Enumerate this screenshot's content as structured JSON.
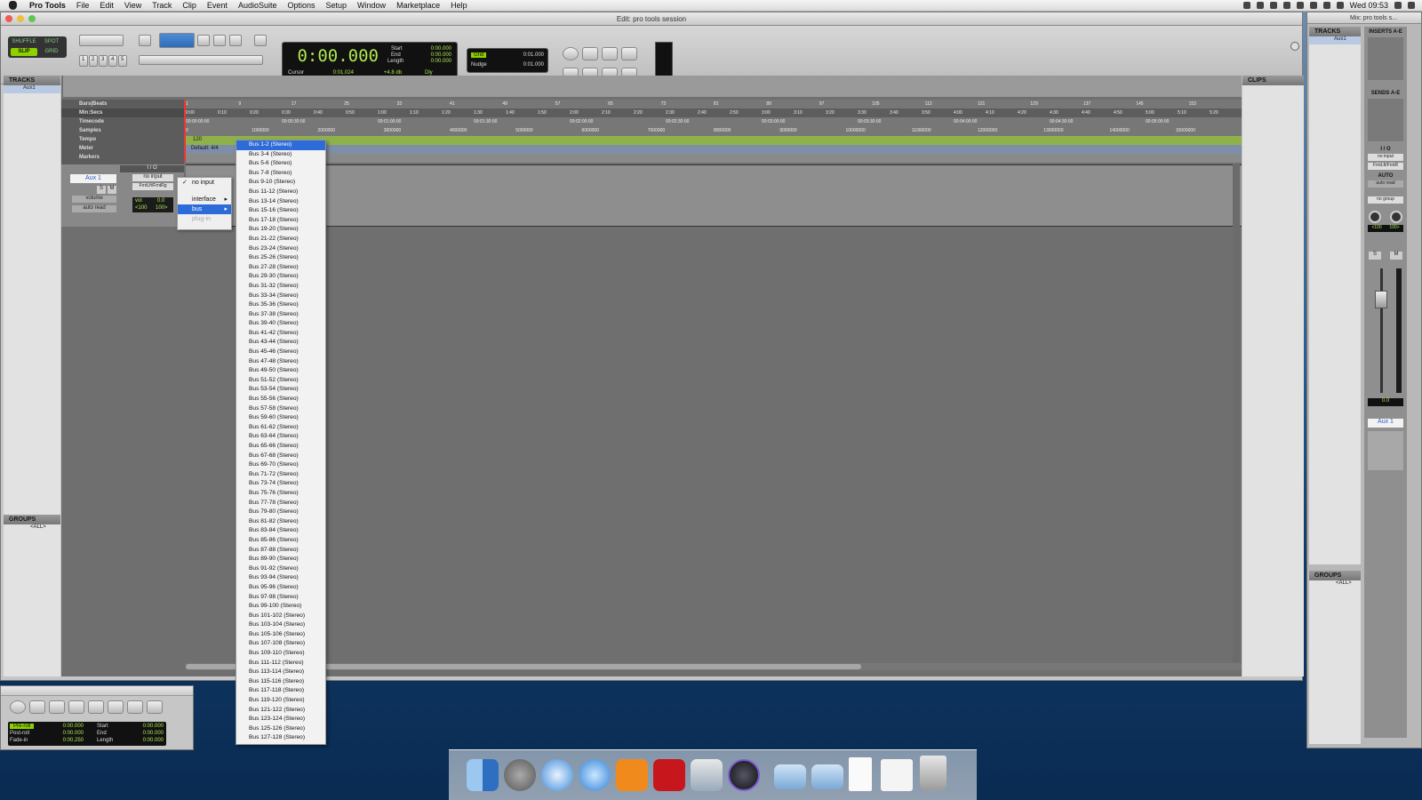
{
  "menubar": {
    "app_name": "Pro Tools",
    "menus": [
      "File",
      "Edit",
      "View",
      "Track",
      "Clip",
      "Event",
      "AudioSuite",
      "Options",
      "Setup",
      "Window",
      "Marketplace",
      "Help"
    ],
    "clock": "Wed 09:53"
  },
  "edit_window": {
    "title": "Edit: pro tools session",
    "modes": {
      "shuffle": "SHUFFLE",
      "spot": "SPOT",
      "slip": "SLIP",
      "grid": "GRID"
    },
    "zoom_presets": [
      "1",
      "2",
      "3",
      "4",
      "5"
    ],
    "counter": {
      "main": "0:00.000",
      "start_label": "Start",
      "start": "0:00.000",
      "end_label": "End",
      "end": "0:00.000",
      "length_label": "Length",
      "length": "0:00.000",
      "cursor_label": "Cursor",
      "cursor": "0:01.024",
      "level": "+4.8 db",
      "dly": "Dly"
    },
    "grid": {
      "grid_label": "Grid",
      "grid_value": "0:01.000",
      "nudge_label": "Nudge",
      "nudge_value": "0:01.000"
    }
  },
  "tracks_panel": {
    "header": "TRACKS",
    "items": [
      "Aux1"
    ]
  },
  "groups_panel": {
    "header": "GROUPS",
    "items": [
      "<ALL>"
    ]
  },
  "clips_panel": {
    "header": "CLIPS"
  },
  "rulers": {
    "labels": [
      "Bars|Beats",
      "Min:Secs",
      "Timecode",
      "Samples",
      "Tempo",
      "Meter",
      "Markers"
    ],
    "bars": [
      "1",
      "9",
      "17",
      "25",
      "33",
      "41",
      "49",
      "57",
      "65",
      "73",
      "81",
      "89",
      "97",
      "105",
      "113",
      "121",
      "129",
      "137",
      "145",
      "153"
    ],
    "minsecs": [
      "0:00",
      "0:10",
      "0:20",
      "0:30",
      "0:40",
      "0:50",
      "1:00",
      "1:10",
      "1:20",
      "1:30",
      "1:40",
      "1:50",
      "2:00",
      "2:10",
      "2:20",
      "2:30",
      "2:40",
      "2:50",
      "3:00",
      "3:10",
      "3:20",
      "3:30",
      "3:40",
      "3:50",
      "4:00",
      "4:10",
      "4:20",
      "4:30",
      "4:40",
      "4:50",
      "5:00",
      "5:10",
      "5:20"
    ],
    "timecode": [
      "00:00:00:00",
      "00:00:30:00",
      "00:01:00:00",
      "00:01:30:00",
      "00:02:00:00",
      "00:02:30:00",
      "00:03:00:00",
      "00:03:30:00",
      "00:04:00:00",
      "00:04:30:00",
      "00:05:00:00"
    ],
    "samples": [
      "0",
      "1000000",
      "2000000",
      "3000000",
      "4000000",
      "5000000",
      "6000000",
      "7000000",
      "8000000",
      "9000000",
      "10000000",
      "11000000",
      "12000000",
      "13000000",
      "14000000",
      "15000000"
    ],
    "tempo_value": "120",
    "meter_value": "Default: 4/4"
  },
  "track": {
    "name": "Aux 1",
    "io_header": "I / O",
    "input": "no input",
    "output": "FrntLft/FrntRg",
    "solo": "S",
    "mute": "M",
    "view": "volume",
    "automation": "auto read",
    "vol_label": "vol",
    "vol_value": "0.0",
    "pan_left": "<100",
    "pan_right": "100>"
  },
  "input_popup": {
    "items": [
      {
        "label": "no input",
        "checked": true
      },
      {
        "label": "interface",
        "arrow": true
      },
      {
        "label": "bus",
        "arrow": true
      },
      {
        "label": "plug-in",
        "disabled": true
      }
    ]
  },
  "bus_menu": {
    "items": [
      "Bus 1-2 (Stereo)",
      "Bus 3-4 (Stereo)",
      "Bus 5-6 (Stereo)",
      "Bus 7-8 (Stereo)",
      "Bus 9-10 (Stereo)",
      "Bus 11-12 (Stereo)",
      "Bus 13-14 (Stereo)",
      "Bus 15-16 (Stereo)",
      "Bus 17-18 (Stereo)",
      "Bus 19-20 (Stereo)",
      "Bus 21-22 (Stereo)",
      "Bus 23-24 (Stereo)",
      "Bus 25-26 (Stereo)",
      "Bus 27-28 (Stereo)",
      "Bus 29-30 (Stereo)",
      "Bus 31-32 (Stereo)",
      "Bus 33-34 (Stereo)",
      "Bus 35-36 (Stereo)",
      "Bus 37-38 (Stereo)",
      "Bus 39-40 (Stereo)",
      "Bus 41-42 (Stereo)",
      "Bus 43-44 (Stereo)",
      "Bus 45-46 (Stereo)",
      "Bus 47-48 (Stereo)",
      "Bus 49-50 (Stereo)",
      "Bus 51-52 (Stereo)",
      "Bus 53-54 (Stereo)",
      "Bus 55-56 (Stereo)",
      "Bus 57-58 (Stereo)",
      "Bus 59-60 (Stereo)",
      "Bus 61-62 (Stereo)",
      "Bus 63-64 (Stereo)",
      "Bus 65-66 (Stereo)",
      "Bus 67-68 (Stereo)",
      "Bus 69-70 (Stereo)",
      "Bus 71-72 (Stereo)",
      "Bus 73-74 (Stereo)",
      "Bus 75-76 (Stereo)",
      "Bus 77-78 (Stereo)",
      "Bus 79-80 (Stereo)",
      "Bus 81-82 (Stereo)",
      "Bus 83-84 (Stereo)",
      "Bus 85-86 (Stereo)",
      "Bus 87-88 (Stereo)",
      "Bus 89-90 (Stereo)",
      "Bus 91-92 (Stereo)",
      "Bus 93-94 (Stereo)",
      "Bus 95-96 (Stereo)",
      "Bus 97-98 (Stereo)",
      "Bus 99-100 (Stereo)",
      "Bus 101-102 (Stereo)",
      "Bus 103-104 (Stereo)",
      "Bus 105-106 (Stereo)",
      "Bus 107-108 (Stereo)",
      "Bus 109-110 (Stereo)",
      "Bus 111-112 (Stereo)",
      "Bus 113-114 (Stereo)",
      "Bus 115-116 (Stereo)",
      "Bus 117-118 (Stereo)",
      "Bus 119-120 (Stereo)",
      "Bus 121-122 (Stereo)",
      "Bus 123-124 (Stereo)",
      "Bus 125-126 (Stereo)",
      "Bus 127-128 (Stereo)"
    ]
  },
  "transport_window": {
    "preroll_label": "Pre-roll",
    "preroll": "0:00.000",
    "postroll_label": "Post-roll",
    "postroll": "0:00.000",
    "fadein_label": "Fade-in",
    "fadein": "0:00.250",
    "start_label": "Start",
    "start": "0:00.000",
    "end_label": "End",
    "end": "0:00.000",
    "length_label": "Length",
    "length": "0:00.000"
  },
  "mix_window": {
    "title": "Mix: pro tools s...",
    "tracks_header": "TRACKS",
    "track_item": "Aux1",
    "inserts_header": "INSERTS A-E",
    "sends_header": "SENDS A-E",
    "io_header": "I / O",
    "input": "no input",
    "output": "FrntLft/FrntR",
    "auto_header": "AUTO",
    "auto_mode": "auto read",
    "group": "no group",
    "pan_left": "<100",
    "pan_right": "100>",
    "solo": "S",
    "mute": "M",
    "fader_value": "0.0",
    "channel_name": "Aux 1",
    "groups_header": "GROUPS",
    "groups_item": "<ALL>"
  },
  "dock": {
    "apps": [
      "finder-icon",
      "launchpad-icon",
      "safari-icon",
      "itunes-icon",
      "ibooks-icon",
      "acrobat-icon",
      "preview-icon",
      "protools-icon",
      "folder-icon",
      "applications-folder-icon",
      "document-icon",
      "textedit-icon",
      "trash-icon"
    ]
  }
}
